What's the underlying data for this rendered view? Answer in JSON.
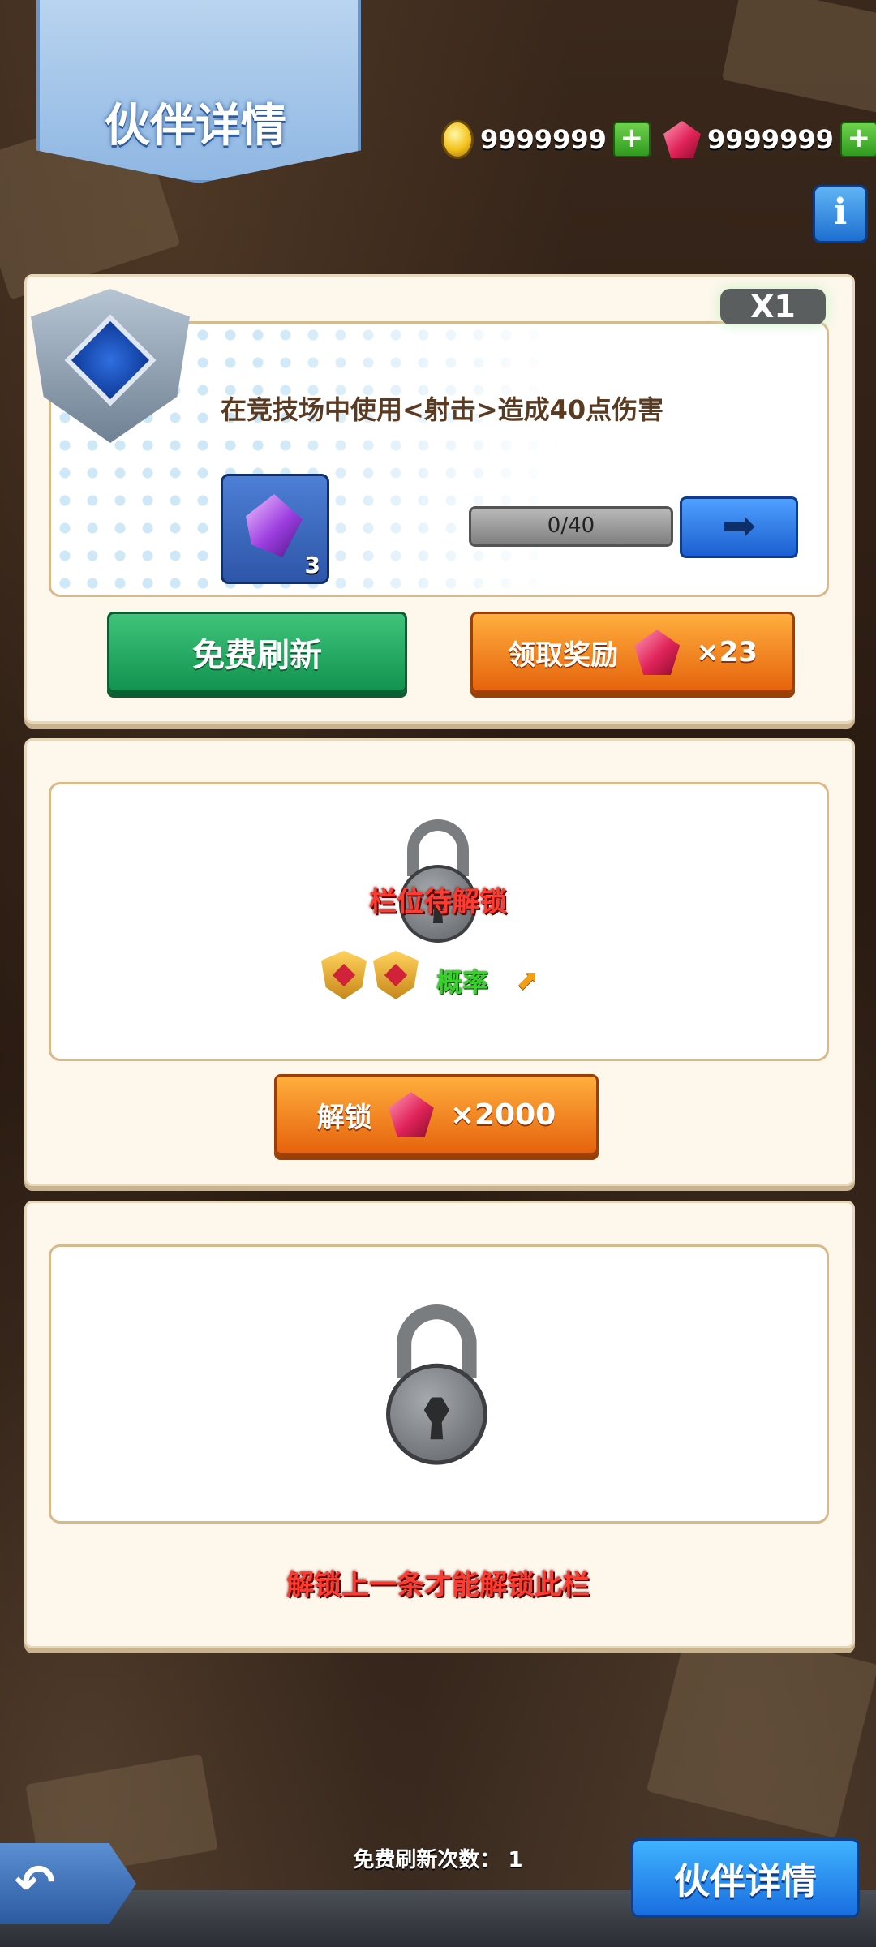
{
  "header": {
    "title": "伙伴详情",
    "coins": "9999999",
    "gems": "9999999",
    "coin_icon": "gold-coin",
    "gem_icon": "red-gem",
    "plus_label": "+",
    "info_label": "i"
  },
  "task_card": {
    "multiplier": "X1",
    "description": "在竞技场中使用<射击>造成40点伤害",
    "reward_item_count": "3",
    "progress_text": "0/40",
    "progress_fraction": 0,
    "go_arrow": "➡",
    "free_refresh_label": "免费刷新",
    "claim_label": "领取奖励",
    "claim_amount": "×23"
  },
  "slot_card": {
    "locked_text": "栏位待解锁",
    "probability_label": "概率",
    "arrow_up": "⬈",
    "unlock_label": "解锁",
    "unlock_cost": "×2000"
  },
  "locked_card": {
    "locked_hint": "解锁上一条才能解锁此栏"
  },
  "footer": {
    "free_refresh_count": "免费刷新次数： 1",
    "back_icon": "↶",
    "partner_button": "伙伴详情"
  },
  "colors": {
    "accent_blue": "#1e6fd0",
    "accent_green": "#12934f",
    "accent_orange": "#e6630d",
    "lock_red": "#ff3b30",
    "probability_green": "#3ad12e"
  }
}
